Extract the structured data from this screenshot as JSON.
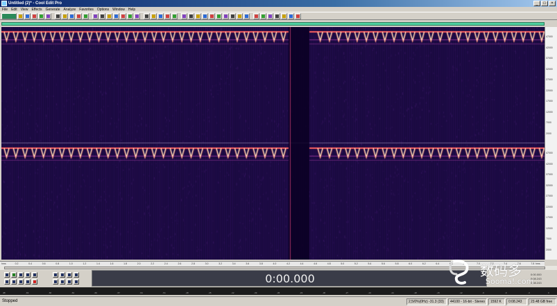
{
  "window": {
    "title": "Untitled (2)* - Cool Edit Pro"
  },
  "menu": {
    "items": [
      "File",
      "Edit",
      "View",
      "Effects",
      "Generate",
      "Analyze",
      "Favorites",
      "Options",
      "Window",
      "Help"
    ]
  },
  "toolbar": {
    "buttons": [
      "new-file-icon",
      "open-file-icon",
      "save-icon",
      "undo-icon",
      "redo-icon",
      "cut-icon",
      "copy-icon",
      "paste-icon",
      "mix-paste-icon",
      "crop-icon",
      "spectral-view-icon",
      "waveform-view-icon",
      "multitrack-icon",
      "cd-icon",
      "loop-icon",
      "script-icon",
      "scroll-icon",
      "marker-icon",
      "grid-icon",
      "time-select-icon",
      "marquee-icon",
      "lasso-icon",
      "effect-icon",
      "filter-icon",
      "noise-icon",
      "amplify-icon",
      "normalize-icon",
      "reverse-icon",
      "invert-icon",
      "silence-icon",
      "tone-icon",
      "dtmf-icon",
      "analyze-icon",
      "statistics-icon",
      "batch-icon",
      "cue-icon",
      "play-list-icon",
      "settings-icon",
      "help-icon"
    ]
  },
  "editor": {
    "view": "spectral",
    "channels": 2,
    "colors": {
      "background": "#1a0a40",
      "tone_bright": "#fff0c8",
      "tone_mid": "#ff6060",
      "tone_dim": "#8a3090",
      "overview": "#4fd0a0"
    },
    "freq_ticks_top": [
      "47000",
      "42000",
      "37000",
      "32000",
      "27000",
      "22000",
      "17000",
      "12000",
      "7000",
      "2000"
    ],
    "freq_ticks_bottom": [
      "47000",
      "42000",
      "37000",
      "32000",
      "27000",
      "22000",
      "17000",
      "12000",
      "7000",
      "2000"
    ],
    "time_ticks": [
      "hms",
      "0.2",
      "0.4",
      "0.6",
      "0.8",
      "1.0",
      "1.2",
      "1.4",
      "1.6",
      "1.8",
      "2.0",
      "2.2",
      "2.4",
      "2.6",
      "2.8",
      "3.0",
      "3.2",
      "3.4",
      "3.6",
      "3.8",
      "4.0",
      "4.2",
      "4.4",
      "4.6",
      "4.8",
      "5.0",
      "5.2",
      "5.4",
      "5.6",
      "5.8",
      "6.0",
      "6.2",
      "6.4",
      "6.6",
      "6.8",
      "7.0",
      "7.2",
      "7.4",
      "7.6",
      "7.8",
      "hms"
    ]
  },
  "transport": {
    "row1": [
      "stop-icon",
      "play-icon",
      "pause-icon",
      "play-to-end-icon",
      "loop-play-icon"
    ],
    "row2": [
      "go-to-start-icon",
      "rewind-icon",
      "fast-forward-icon",
      "go-to-end-icon",
      "record-icon"
    ],
    "zoom": [
      "zoom-in-horizontal-icon",
      "zoom-out-horizontal-icon",
      "zoom-full-icon",
      "zoom-in-left-icon",
      "zoom-in-right-icon",
      "zoom-selection-icon",
      "zoom-in-vertical-icon",
      "zoom-out-vertical-icon"
    ]
  },
  "time_display": {
    "value": "0:00.000"
  },
  "selection": {
    "begin": "0:00.000",
    "end": "0:08.243",
    "length": "0:08.243"
  },
  "level_meter": {
    "scale": [
      "dB",
      "-69",
      "-66",
      "-63",
      "-60",
      "-57",
      "-54",
      "-51",
      "-48",
      "-45",
      "-42",
      "-39",
      "-36",
      "-33",
      "-30",
      "-27",
      "-24",
      "-21",
      "-18",
      "-15",
      "-12",
      "-9",
      "-6",
      "-3",
      "0"
    ]
  },
  "status": {
    "left": "Stopped",
    "fields": [
      "2,5/0%(0Hz) -31.3 (33)",
      "44100 - 16-bit - Stereo",
      "1592 K",
      "0:08.243",
      "23.48 GB free"
    ]
  },
  "watermark": {
    "brand": "数码多",
    "site": "Sooma!.com"
  }
}
